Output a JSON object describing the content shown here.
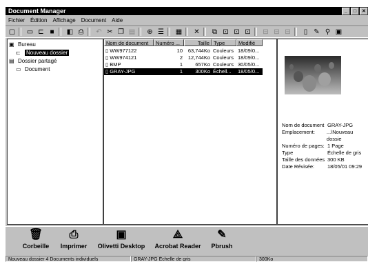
{
  "window": {
    "title": "Document Manager",
    "controls": [
      "_",
      "□",
      "✕"
    ]
  },
  "menu": [
    "Fichier",
    "Édition",
    "Affichage",
    "Document",
    "Aide"
  ],
  "tree": {
    "items": [
      {
        "label": "Bureau"
      },
      {
        "label": "Nouveau dossier"
      },
      {
        "label": "Dossier partagé"
      },
      {
        "label": "Document"
      }
    ]
  },
  "list": {
    "columns": [
      "Nom de document",
      "Numéro ...",
      "Taille",
      "Type",
      "Modifié"
    ],
    "rows": [
      {
        "name": "WW977122",
        "num": "10",
        "size": "63,744Ko",
        "type": "Couleurs",
        "modified": "18/09/0..."
      },
      {
        "name": "WW974121",
        "num": "2",
        "size": "12,744Ko",
        "type": "Couleurs",
        "modified": "18/09/0..."
      },
      {
        "name": "BMP",
        "num": "1",
        "size": "657Ko",
        "type": "Couleurs",
        "modified": "30/05/0..."
      },
      {
        "name": "GRAY-JPG",
        "num": "1",
        "size": "300Ko",
        "type": "Échell...",
        "modified": "18/05/0..."
      }
    ]
  },
  "details": {
    "props": [
      {
        "k": "Nom de document",
        "v": "GRAY-JPG"
      },
      {
        "k": "Emplacement:",
        "v": "...\\Nouveau dossie"
      },
      {
        "k": "Numéro de pages:",
        "v": "1 Page"
      },
      {
        "k": "Type",
        "v": "Échelle de gris"
      },
      {
        "k": "Taille des données",
        "v": "300 KB"
      },
      {
        "k": "Date Révisée:",
        "v": "18/05/01 09:29"
      }
    ]
  },
  "dock": {
    "apps": [
      {
        "label": "Corbeille",
        "icon": "trash-icon"
      },
      {
        "label": "Imprimer",
        "icon": "printer-icon"
      },
      {
        "label": "Olivetti Desktop",
        "icon": "desktop-icon"
      },
      {
        "label": "Acrobat Reader",
        "icon": "acrobat-icon"
      },
      {
        "label": "Pbrush",
        "icon": "paint-icon"
      }
    ]
  },
  "status": {
    "left": "Nouveau dossier  4 Documents individuels",
    "mid": "GRAY-JPG  Échelle de gris",
    "right": "300Ko"
  }
}
